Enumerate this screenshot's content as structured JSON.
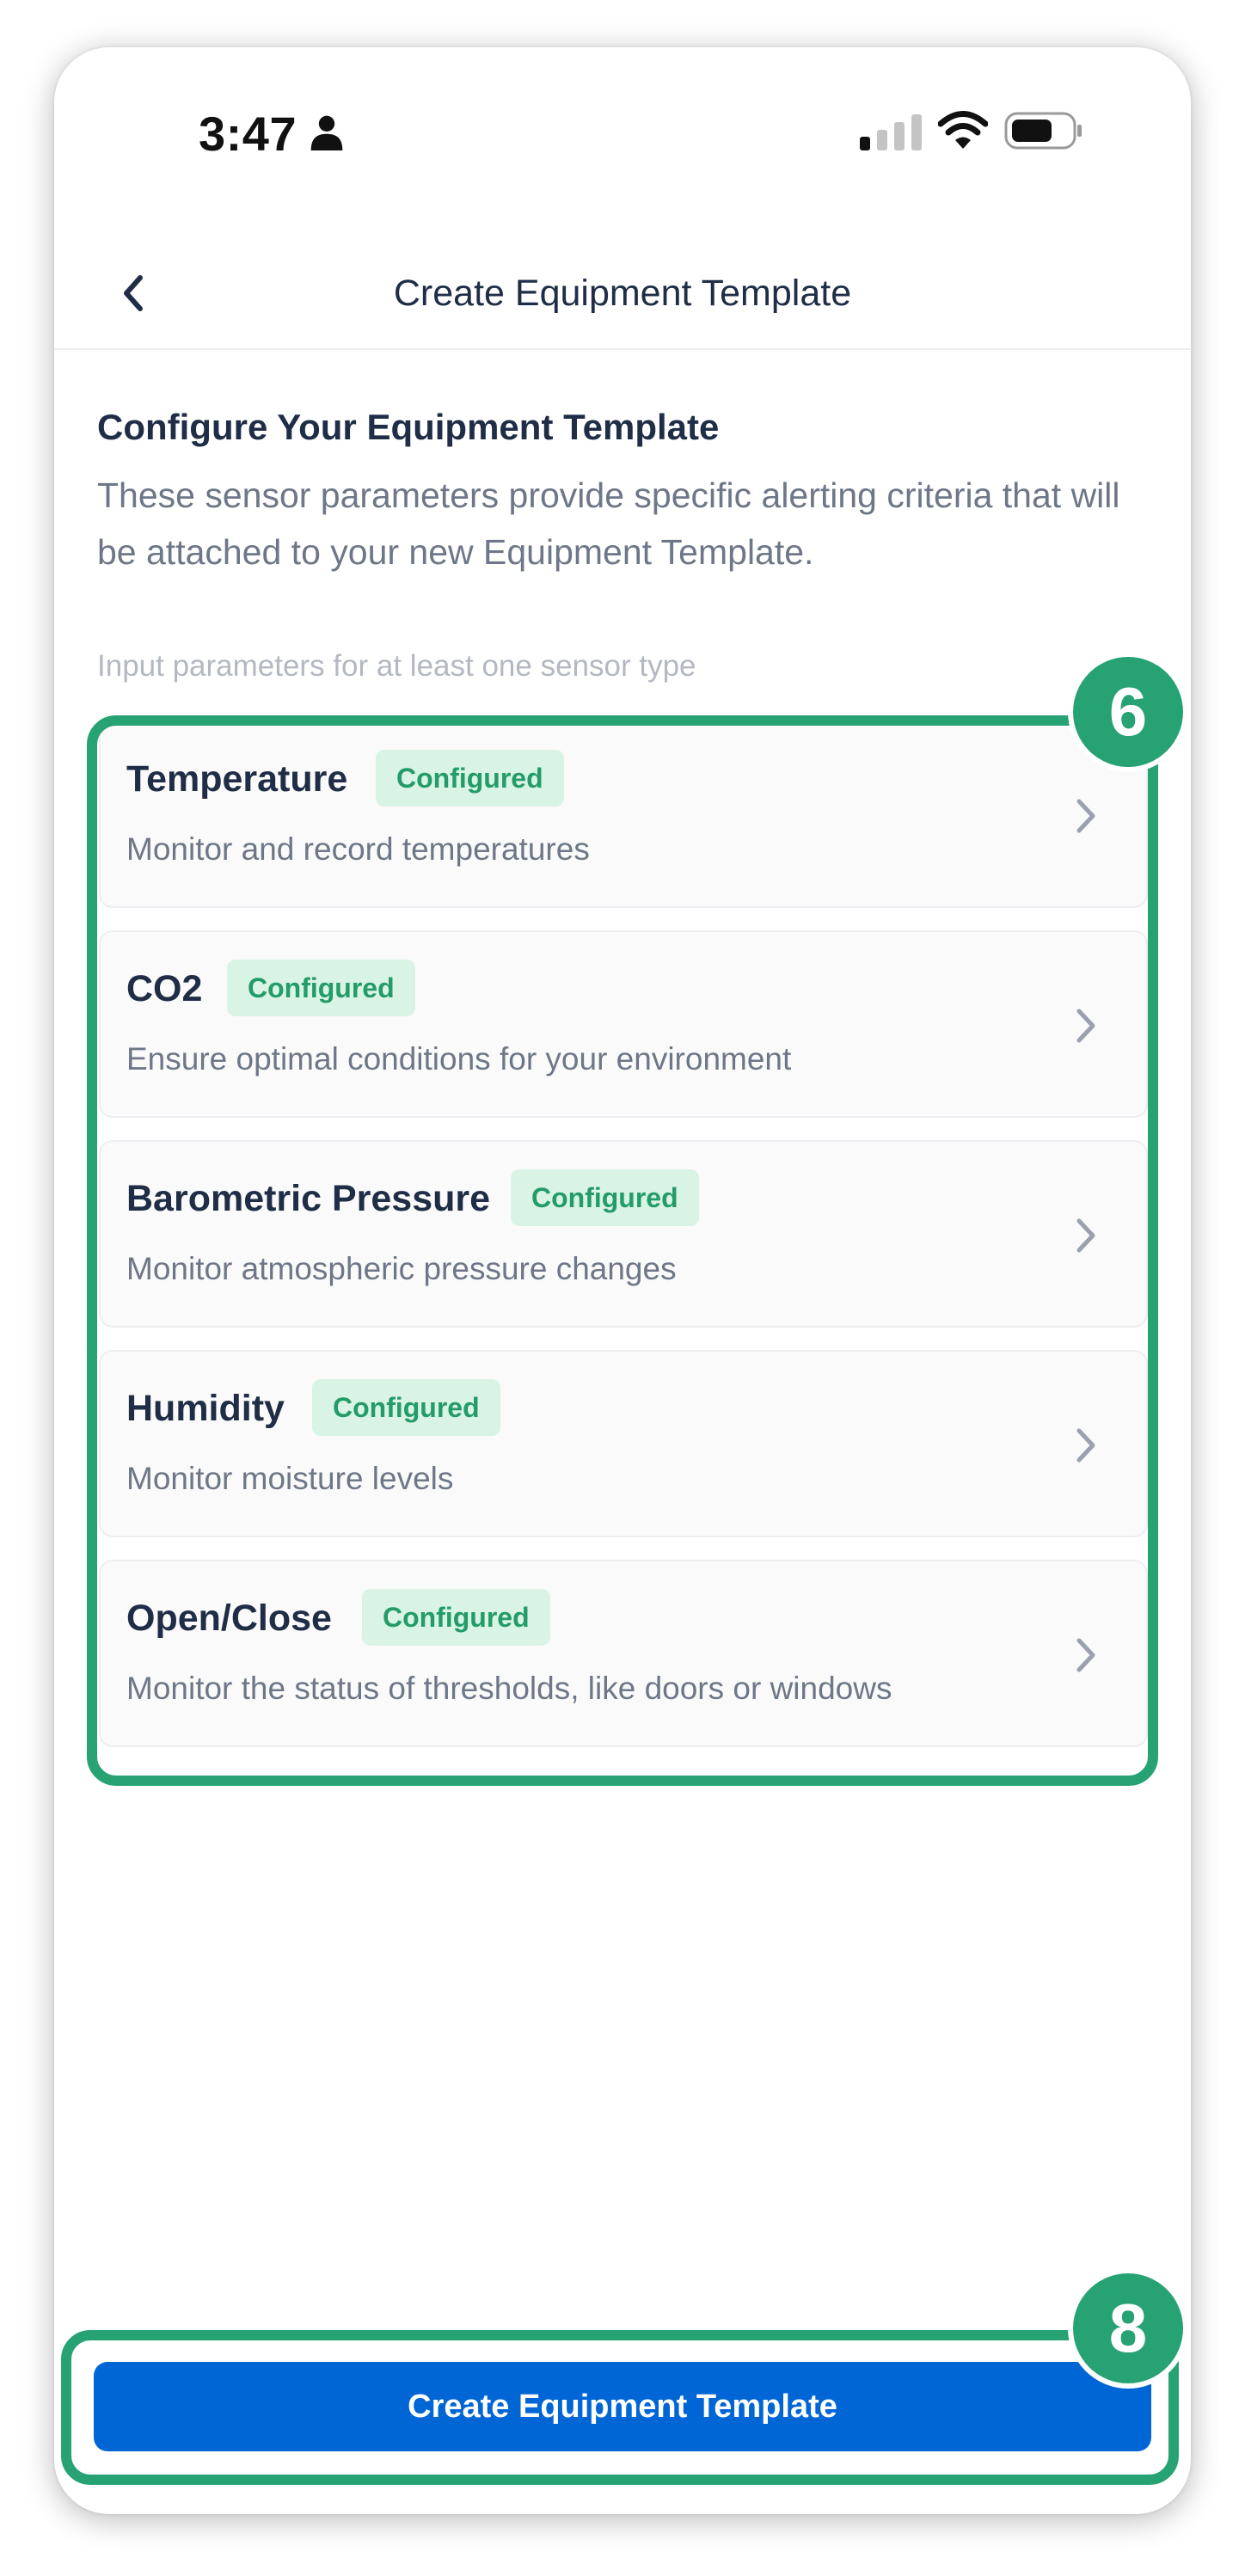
{
  "status_bar": {
    "time": "3:47"
  },
  "header": {
    "title": "Create Equipment Template",
    "back_icon": "chevron-left-icon"
  },
  "intro": {
    "title": "Configure Your Equipment Template",
    "description": "These sensor parameters provide specific alerting criteria that will be attached to your new Equipment Template.",
    "hint": "Input parameters for at least one sensor type"
  },
  "sensors": [
    {
      "name": "Temperature",
      "status": "Configured",
      "description": "Monitor and record temperatures"
    },
    {
      "name": "CO2",
      "status": "Configured",
      "description": "Ensure optimal conditions for your environment"
    },
    {
      "name": "Barometric Pressure",
      "status": "Configured",
      "description": "Monitor atmospheric pressure changes"
    },
    {
      "name": "Humidity",
      "status": "Configured",
      "description": "Monitor moisture levels"
    },
    {
      "name": "Open/Close",
      "status": "Configured",
      "description": "Monitor the status of thresholds, like doors or windows"
    }
  ],
  "footer": {
    "button_label": "Create Equipment Template"
  },
  "annotations": {
    "list_step": "6",
    "button_step": "8"
  },
  "colors": {
    "accent_blue": "#0066d6",
    "badge_bg": "#d9f3e5",
    "badge_text": "#239c68",
    "annotation_green": "#27a273",
    "text_primary": "#1f2d46",
    "text_secondary": "#6e7787"
  }
}
